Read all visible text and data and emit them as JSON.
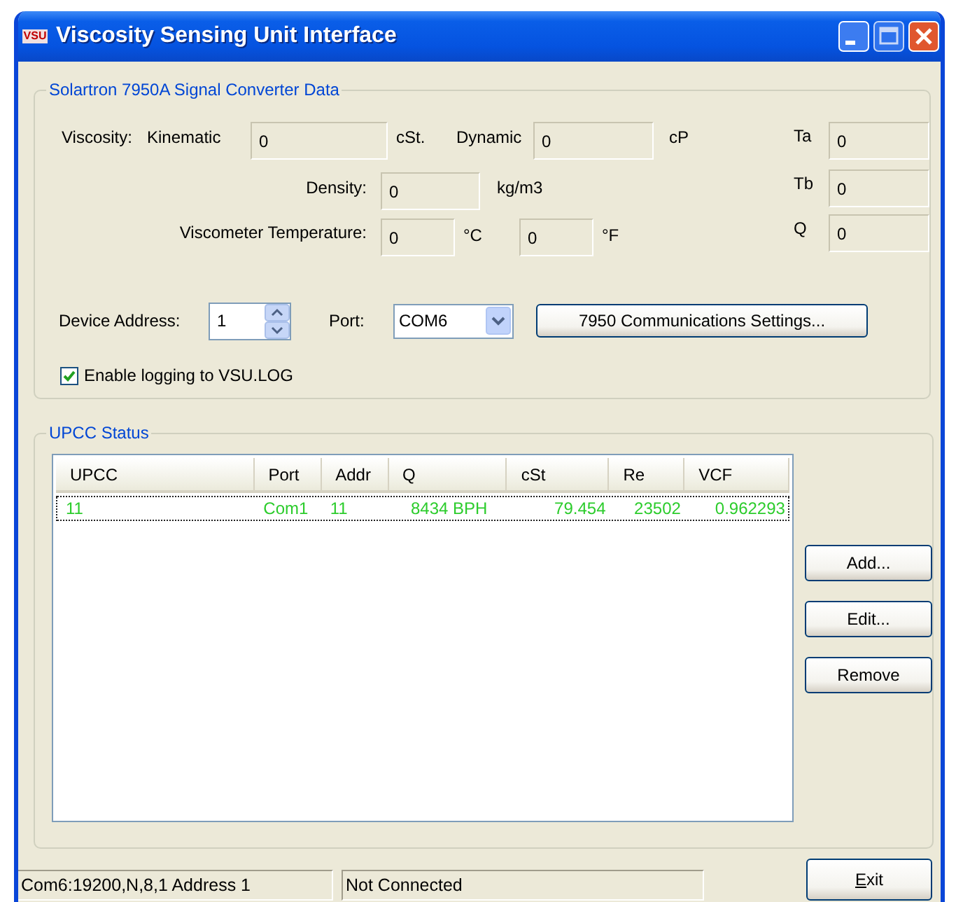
{
  "window": {
    "title": "Viscosity Sensing Unit Interface",
    "icon_text": "VSU"
  },
  "converter_group": {
    "title": "Solartron 7950A Signal Converter Data",
    "viscosity": {
      "label": "Viscosity:",
      "kinematic_label": "Kinematic",
      "kinematic_value": "0",
      "kinematic_unit": "cSt.",
      "dynamic_label": "Dynamic",
      "dynamic_value": "0",
      "dynamic_unit": "cP"
    },
    "density": {
      "label": "Density:",
      "value": "0",
      "unit": "kg/m3"
    },
    "temperature": {
      "label": "Viscometer Temperature:",
      "celsius_value": "0",
      "celsius_unit": "°C",
      "fahrenheit_value": "0",
      "fahrenheit_unit": "°F"
    },
    "side_readings": [
      {
        "label": "Ta",
        "value": "0"
      },
      {
        "label": "Tb",
        "value": "0"
      },
      {
        "label": "Q",
        "value": "0"
      }
    ],
    "device_address": {
      "label": "Device Address:",
      "value": "1"
    },
    "port": {
      "label": "Port:",
      "value": "COM6"
    },
    "settings_button": "7950 Communications Settings...",
    "logging": {
      "label": "Enable logging to VSU.LOG",
      "checked": true
    }
  },
  "upcc_group": {
    "title": "UPCC Status",
    "columns": [
      "UPCC",
      "Port",
      "Addr",
      "Q",
      "cSt",
      "Re",
      "VCF"
    ],
    "rows": [
      {
        "cells": [
          "11",
          "Com1",
          "11",
          "8434 BPH",
          "79.454",
          "23502",
          "0.962293"
        ],
        "selected": true
      }
    ],
    "buttons": [
      "Add...",
      "Edit...",
      "Remove"
    ]
  },
  "status_bar": [
    "Com6:19200,N,8,1 Address 1",
    "Not Connected"
  ],
  "exit_button": {
    "label": "Exit",
    "underline_first": true
  }
}
